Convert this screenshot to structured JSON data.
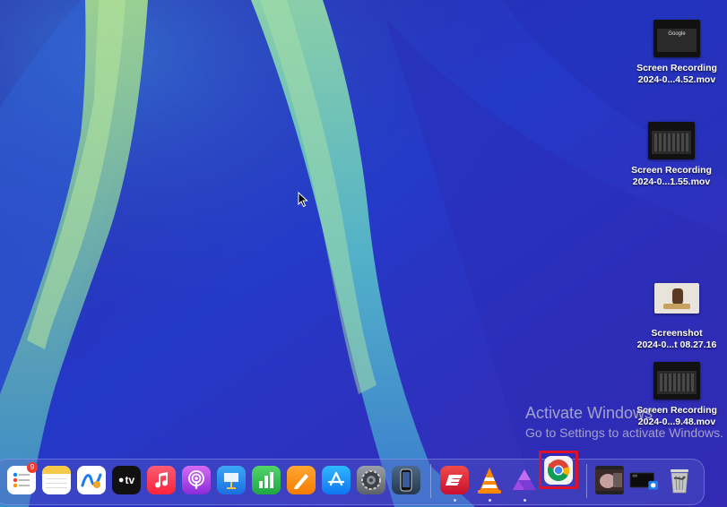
{
  "desktop": {
    "files": [
      {
        "line1": "Screen Recording",
        "line2": "2024-0...4.52.mov",
        "thumb_caption": "Google"
      },
      {
        "line1": "Screen Recording",
        "line2": "2024-0...1.55.mov"
      },
      {
        "line1": "Screenshot",
        "line2": "2024-0...t 08.27.16"
      },
      {
        "line1": "Screen Recording",
        "line2": "2024-0...9.48.mov"
      }
    ]
  },
  "watermark": {
    "line1": "Activate Windows",
    "line2": "Go to Settings to activate Windows."
  },
  "dock": {
    "reminders_badge": "9",
    "apple_tv_label": "tv",
    "items": [
      "reminders-icon",
      "notes-icon",
      "freeform-icon",
      "apple-tv-icon",
      "music-icon",
      "podcasts-icon",
      "keynote-icon",
      "numbers-icon",
      "pages-icon",
      "app-store-icon",
      "system-settings-icon",
      "iphone-mirroring-icon",
      "expressvpn-icon",
      "vlc-icon",
      "affinity-photo-icon",
      "chrome-icon",
      "downloads-stack-icon",
      "screenshots-stack-icon",
      "trash-icon"
    ]
  },
  "colors": {
    "wallpaper_base": "#2a2fb8",
    "wallpaper_streak": "#6fc6c8",
    "highlight": "#e0102a"
  }
}
